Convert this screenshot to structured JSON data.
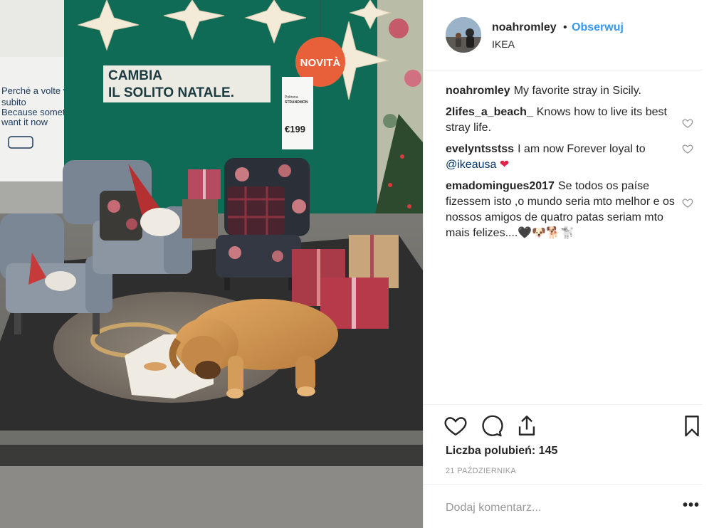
{
  "post": {
    "photo_sign": {
      "line1": "CAMBIA",
      "line2": "IL SOLITO NATALE.",
      "badge": "NOVITÀ",
      "price": "€199",
      "product": "Poltrona",
      "product_name": "STRANDMON",
      "left_wall_line1": "Perché a volte vi",
      "left_wall_line2": "subito",
      "left_wall_line3": "Because somet",
      "left_wall_line4": "want it now"
    }
  },
  "header": {
    "username": "noahromley",
    "separator": "•",
    "follow_label": "Obserwuj",
    "location": "IKEA"
  },
  "comments": [
    {
      "user": "noahromley",
      "text": "My favorite stray in Sicily."
    },
    {
      "user": "2lifes_a_beach_",
      "text": "Knows how to live its best stray life."
    },
    {
      "user": "evelyntsstss",
      "text": "I am now Forever loyal to ",
      "mention": "@ikeausa",
      "emoji": "❤"
    },
    {
      "user": "emadomingues2017",
      "text": "Se todos os paíse fizessem isto ,o mundo seria mto melhor e os nossos amigos de quatro patas seriam mto mais felizes....🖤🐶🐕🐩"
    }
  ],
  "actions": {
    "like_icon": "heart-icon",
    "comment_icon": "comment-icon",
    "share_icon": "share-icon",
    "save_icon": "bookmark-icon"
  },
  "likes_text": "Liczba polubień: 145",
  "date": "21 PAŹDZIERNIKA",
  "comment_box": {
    "placeholder": "Dodaj komentarz...",
    "more": "•••"
  },
  "colors": {
    "link_blue": "#3897f0",
    "wall_green": "#0f6b55",
    "badge_orange": "#e8603a"
  }
}
